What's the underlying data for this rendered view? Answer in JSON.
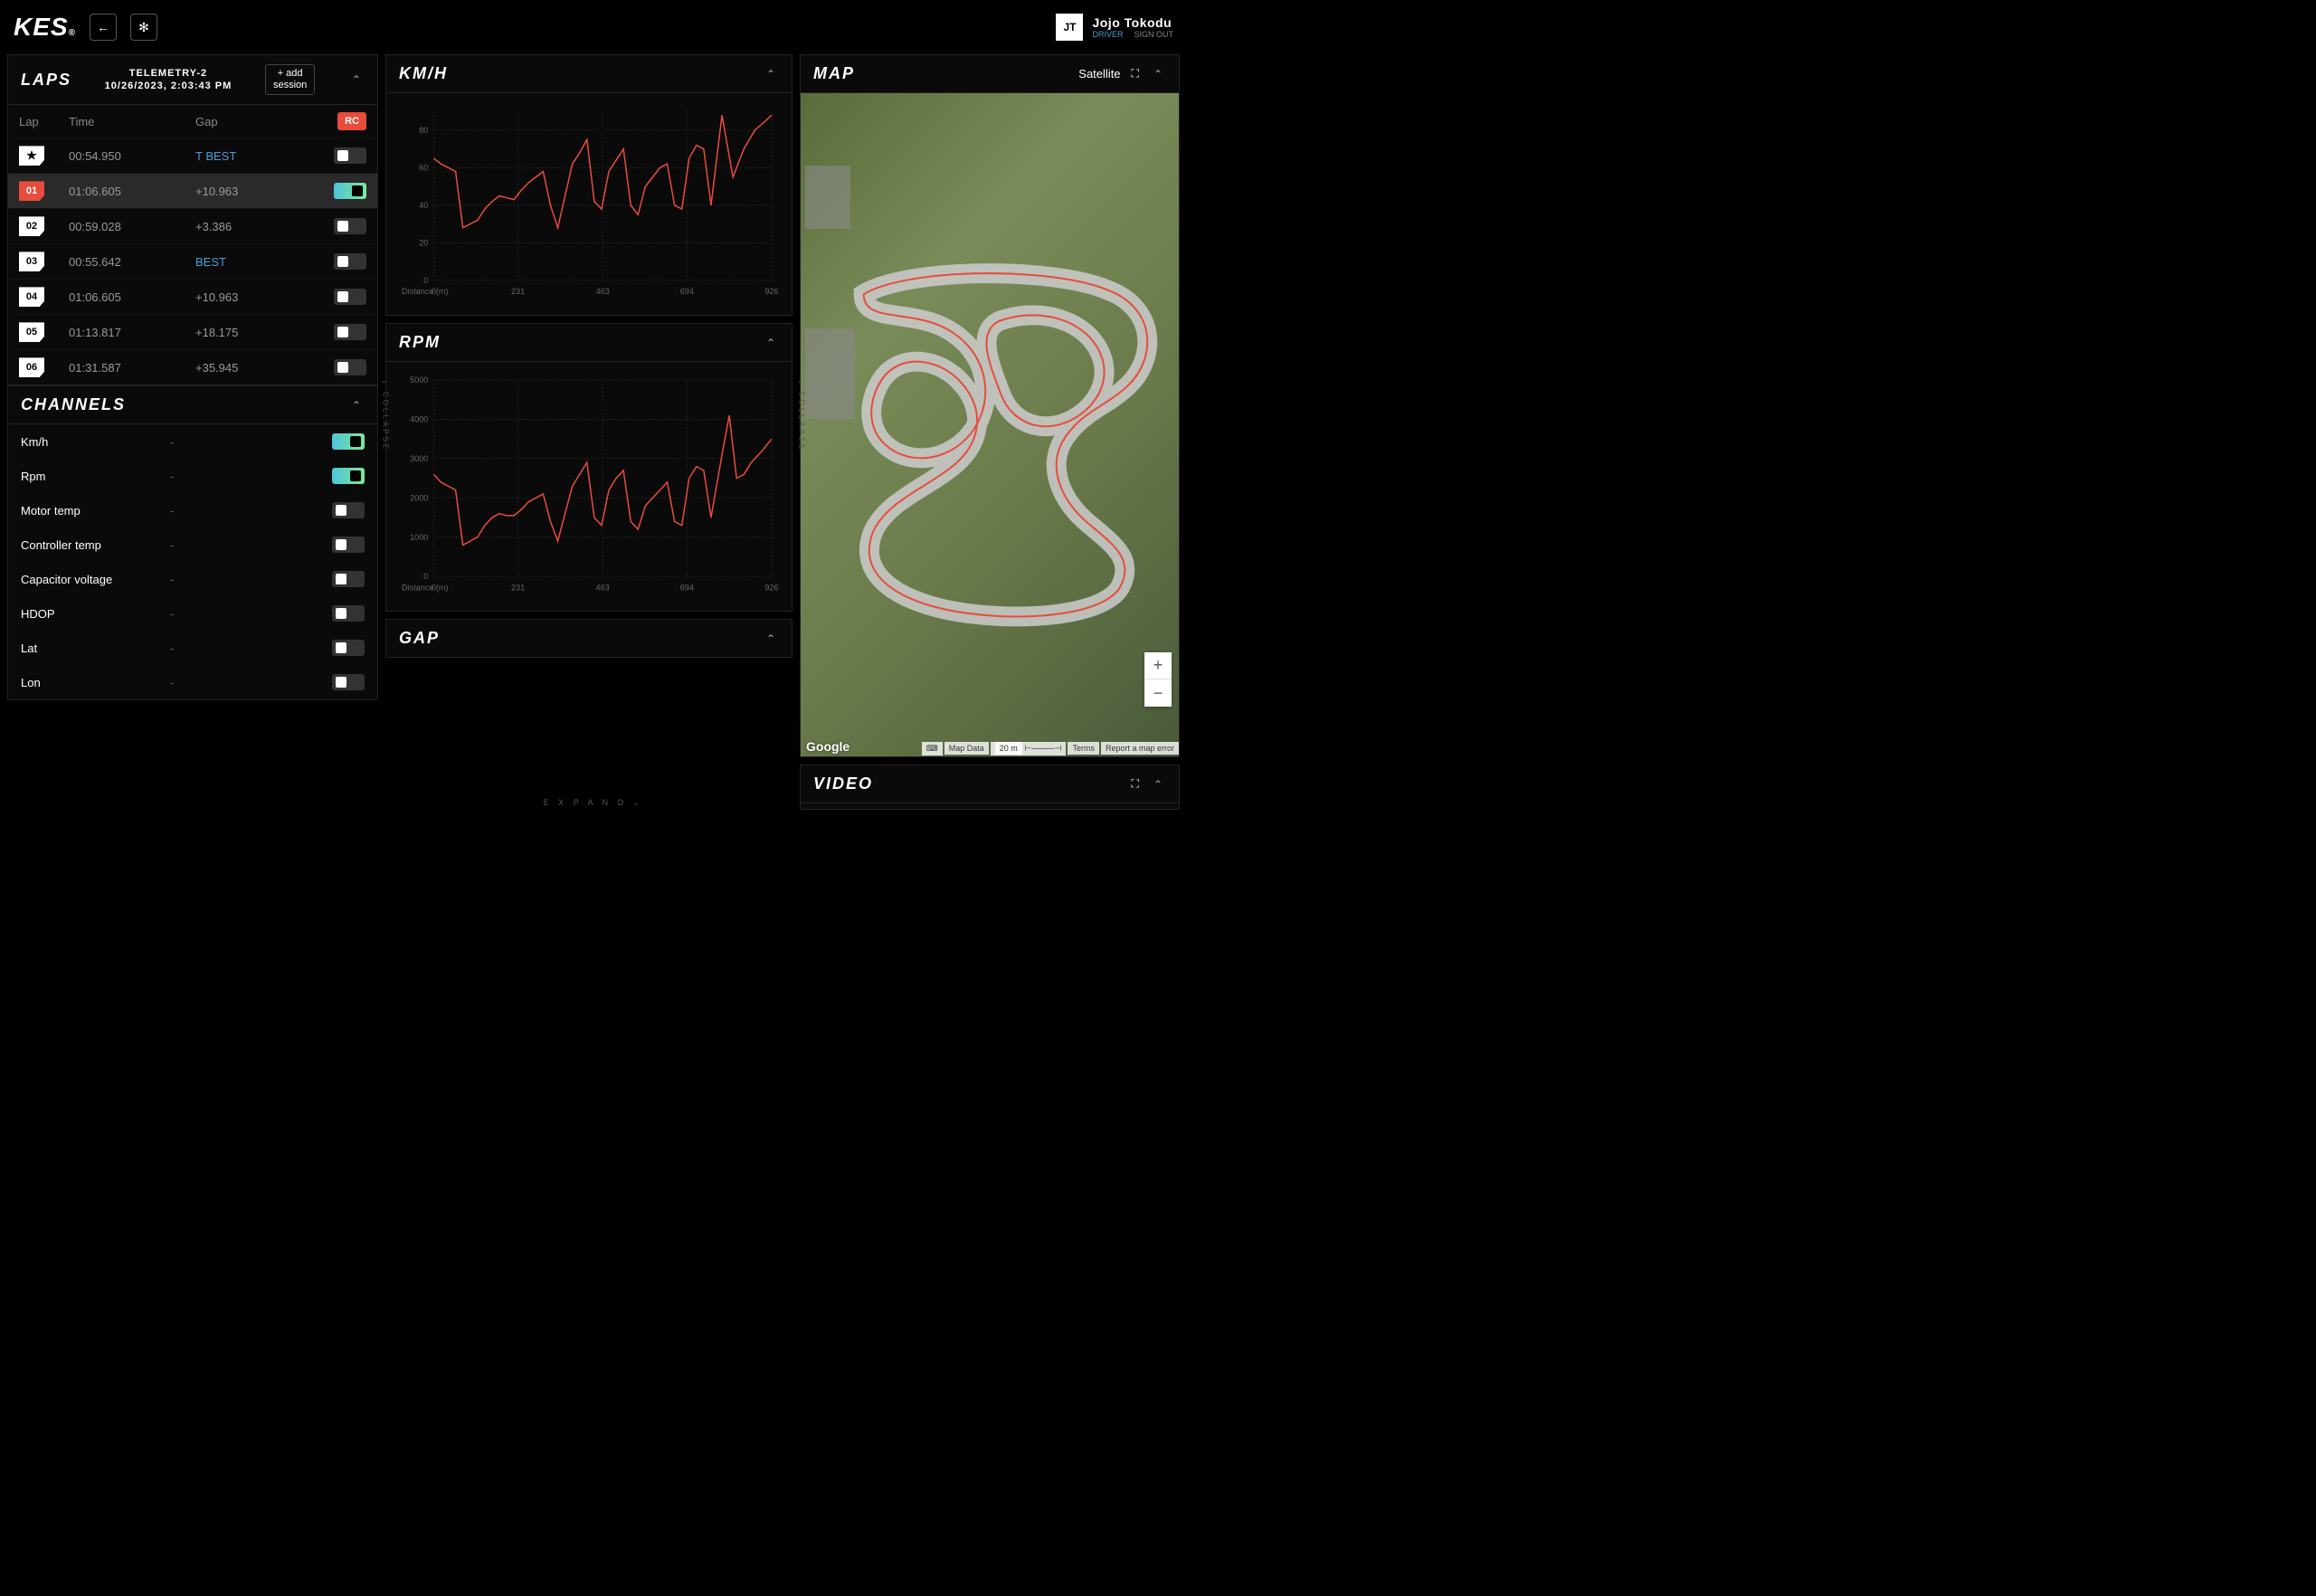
{
  "logo": "KES",
  "user": {
    "initials": "JT",
    "name": "Jojo Tokodu",
    "role": "DRIVER",
    "signout": "SIGN OUT"
  },
  "laps_panel": {
    "title": "LAPS",
    "session_name": "TELEMETRY-2",
    "session_time": "10/26/2023, 2:03:43 PM",
    "add_btn": "+ add session",
    "cols": {
      "lap": "Lap",
      "time": "Time",
      "gap": "Gap"
    },
    "rc": "RC",
    "rows": [
      {
        "num": "★",
        "time": "00:54.950",
        "gap": "T BEST",
        "best": true,
        "star": true,
        "selected": false,
        "on": false
      },
      {
        "num": "01",
        "time": "01:06.605",
        "gap": "+10.963",
        "best": false,
        "selected": true,
        "red": true,
        "on": true
      },
      {
        "num": "02",
        "time": "00:59.028",
        "gap": "+3.386",
        "best": false,
        "selected": false,
        "on": false
      },
      {
        "num": "03",
        "time": "00:55.642",
        "gap": "BEST",
        "best": true,
        "selected": false,
        "on": false
      },
      {
        "num": "04",
        "time": "01:06.605",
        "gap": "+10.963",
        "best": false,
        "selected": false,
        "on": false
      },
      {
        "num": "05",
        "time": "01:13.817",
        "gap": "+18.175",
        "best": false,
        "selected": false,
        "on": false
      },
      {
        "num": "06",
        "time": "01:31.587",
        "gap": "+35.945",
        "best": false,
        "selected": false,
        "on": false
      }
    ]
  },
  "channels_panel": {
    "title": "CHANNELS",
    "rows": [
      {
        "name": "Km/h",
        "val": "-",
        "on": true
      },
      {
        "name": "Rpm",
        "val": "-",
        "on": true
      },
      {
        "name": "Motor temp",
        "val": "-",
        "on": false
      },
      {
        "name": "Controller temp",
        "val": "-",
        "on": false
      },
      {
        "name": "Capacitor voltage",
        "val": "-",
        "on": false
      },
      {
        "name": "HDOP",
        "val": "-",
        "on": false
      },
      {
        "name": "Lat",
        "val": "-",
        "on": false
      },
      {
        "name": "Lon",
        "val": "-",
        "on": false
      }
    ]
  },
  "charts": {
    "xaxis_label": "Distance (m)",
    "kmh": {
      "title": "KM/H"
    },
    "rpm": {
      "title": "RPM"
    },
    "gap": {
      "title": "GAP"
    }
  },
  "map_panel": {
    "title": "MAP",
    "view_type": "Satellite",
    "attrib": {
      "mapdata": "Map Data",
      "scale": "20 m",
      "terms": "Terms",
      "report": "Report a map error"
    },
    "google": "Google"
  },
  "video_panel": {
    "title": "VIDEO"
  },
  "rails": {
    "collapse": "COLLAPSE",
    "expand": "E X P A N D"
  },
  "chart_data": [
    {
      "type": "line",
      "title": "KM/H",
      "xlabel": "Distance (m)",
      "ylabel": "",
      "xlim": [
        0,
        926
      ],
      "ylim": [
        0,
        90
      ],
      "x_ticks": [
        0,
        231,
        463,
        694,
        926
      ],
      "y_ticks": [
        0,
        20,
        40,
        60,
        80
      ],
      "series": [
        {
          "name": "Lap 01",
          "color": "#e74c3c",
          "x": [
            0,
            20,
            40,
            60,
            80,
            100,
            120,
            140,
            160,
            180,
            200,
            220,
            240,
            260,
            280,
            300,
            320,
            340,
            360,
            380,
            400,
            420,
            440,
            460,
            480,
            500,
            520,
            540,
            560,
            580,
            600,
            620,
            640,
            660,
            680,
            700,
            720,
            740,
            760,
            790,
            820,
            850,
            880,
            910,
            926
          ],
          "y": [
            65,
            62,
            60,
            58,
            28,
            30,
            32,
            38,
            42,
            45,
            44,
            43,
            48,
            52,
            55,
            58,
            40,
            28,
            45,
            62,
            68,
            75,
            42,
            38,
            58,
            64,
            70,
            40,
            35,
            50,
            55,
            60,
            62,
            40,
            38,
            65,
            72,
            70,
            40,
            88,
            55,
            70,
            80,
            85,
            88
          ]
        }
      ]
    },
    {
      "type": "line",
      "title": "RPM",
      "xlabel": "Distance (m)",
      "ylabel": "",
      "xlim": [
        0,
        926
      ],
      "ylim": [
        0,
        5000
      ],
      "x_ticks": [
        0,
        231,
        463,
        694,
        926
      ],
      "y_ticks": [
        0,
        1000,
        2000,
        3000,
        4000,
        5000
      ],
      "series": [
        {
          "name": "Lap 01",
          "color": "#e74c3c",
          "x": [
            0,
            20,
            40,
            60,
            80,
            100,
            120,
            140,
            160,
            180,
            200,
            220,
            240,
            260,
            280,
            300,
            320,
            340,
            360,
            380,
            400,
            420,
            440,
            460,
            480,
            500,
            520,
            540,
            560,
            580,
            600,
            620,
            640,
            660,
            680,
            700,
            720,
            740,
            760,
            790,
            810,
            830,
            850,
            870,
            900,
            926
          ],
          "y": [
            2600,
            2400,
            2300,
            2200,
            800,
            900,
            1000,
            1300,
            1500,
            1600,
            1550,
            1550,
            1700,
            1900,
            2000,
            2100,
            1400,
            900,
            1600,
            2300,
            2600,
            2900,
            1500,
            1300,
            2200,
            2500,
            2700,
            1400,
            1200,
            1800,
            2000,
            2200,
            2400,
            1400,
            1300,
            2500,
            2800,
            2700,
            1500,
            3100,
            4100,
            2500,
            2600,
            2900,
            3200,
            3500
          ]
        }
      ]
    }
  ]
}
